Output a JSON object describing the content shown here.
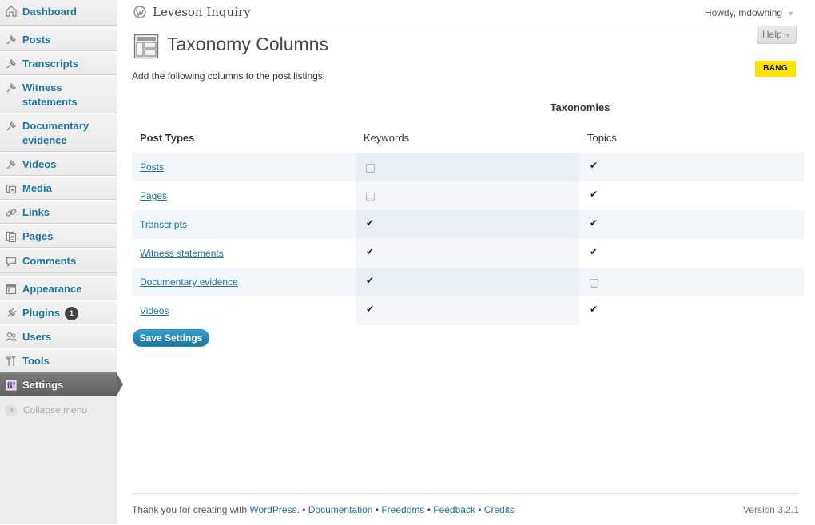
{
  "site_title": "Leveson Inquiry",
  "user_greeting": "Howdy, mdowning",
  "help_label": "Help",
  "sidebar": {
    "items": [
      {
        "label": "Dashboard",
        "icon": "dashboard-icon"
      },
      {
        "label": "Posts",
        "icon": "pin-icon"
      },
      {
        "label": "Transcripts",
        "icon": "pin-icon"
      },
      {
        "label": "Witness statements",
        "icon": "pin-icon"
      },
      {
        "label": "Documentary evidence",
        "icon": "pin-icon"
      },
      {
        "label": "Videos",
        "icon": "pin-icon"
      },
      {
        "label": "Media",
        "icon": "media-icon"
      },
      {
        "label": "Links",
        "icon": "links-icon"
      },
      {
        "label": "Pages",
        "icon": "pages-icon"
      },
      {
        "label": "Comments",
        "icon": "comments-icon"
      },
      {
        "label": "Appearance",
        "icon": "appearance-icon"
      },
      {
        "label": "Plugins",
        "icon": "plugins-icon",
        "badge": "1"
      },
      {
        "label": "Users",
        "icon": "users-icon"
      },
      {
        "label": "Tools",
        "icon": "tools-icon"
      },
      {
        "label": "Settings",
        "icon": "settings-icon",
        "current": true
      }
    ],
    "collapse_label": "Collapse menu"
  },
  "page": {
    "title": "Taxonomy Columns",
    "badge": "BANG",
    "intro": "Add the following columns to the post listings:",
    "taxonomies_heading": "Taxonomies",
    "col_post_types": "Post Types",
    "col_keywords": "Keywords",
    "col_topics": "Topics",
    "rows": [
      {
        "label": "Posts",
        "keywords": false,
        "topics": true
      },
      {
        "label": "Pages",
        "keywords": false,
        "topics": true
      },
      {
        "label": "Transcripts",
        "keywords": true,
        "topics": true
      },
      {
        "label": "Witness statements",
        "keywords": true,
        "topics": true
      },
      {
        "label": "Documentary evidence",
        "keywords": true,
        "topics": false
      },
      {
        "label": "Videos",
        "keywords": true,
        "topics": true
      }
    ],
    "save_label": "Save Settings"
  },
  "footer": {
    "thanks": "Thank you for creating with ",
    "wordpress": "WordPress.",
    "sep": " • ",
    "documentation": "Documentation",
    "freedoms": "Freedoms",
    "feedback": "Feedback",
    "credits": "Credits",
    "version": "Version 3.2.1"
  },
  "colors": {
    "link": "#21759b",
    "current_menu": "#6d6d6d",
    "badge_yellow": "#ffe300"
  }
}
